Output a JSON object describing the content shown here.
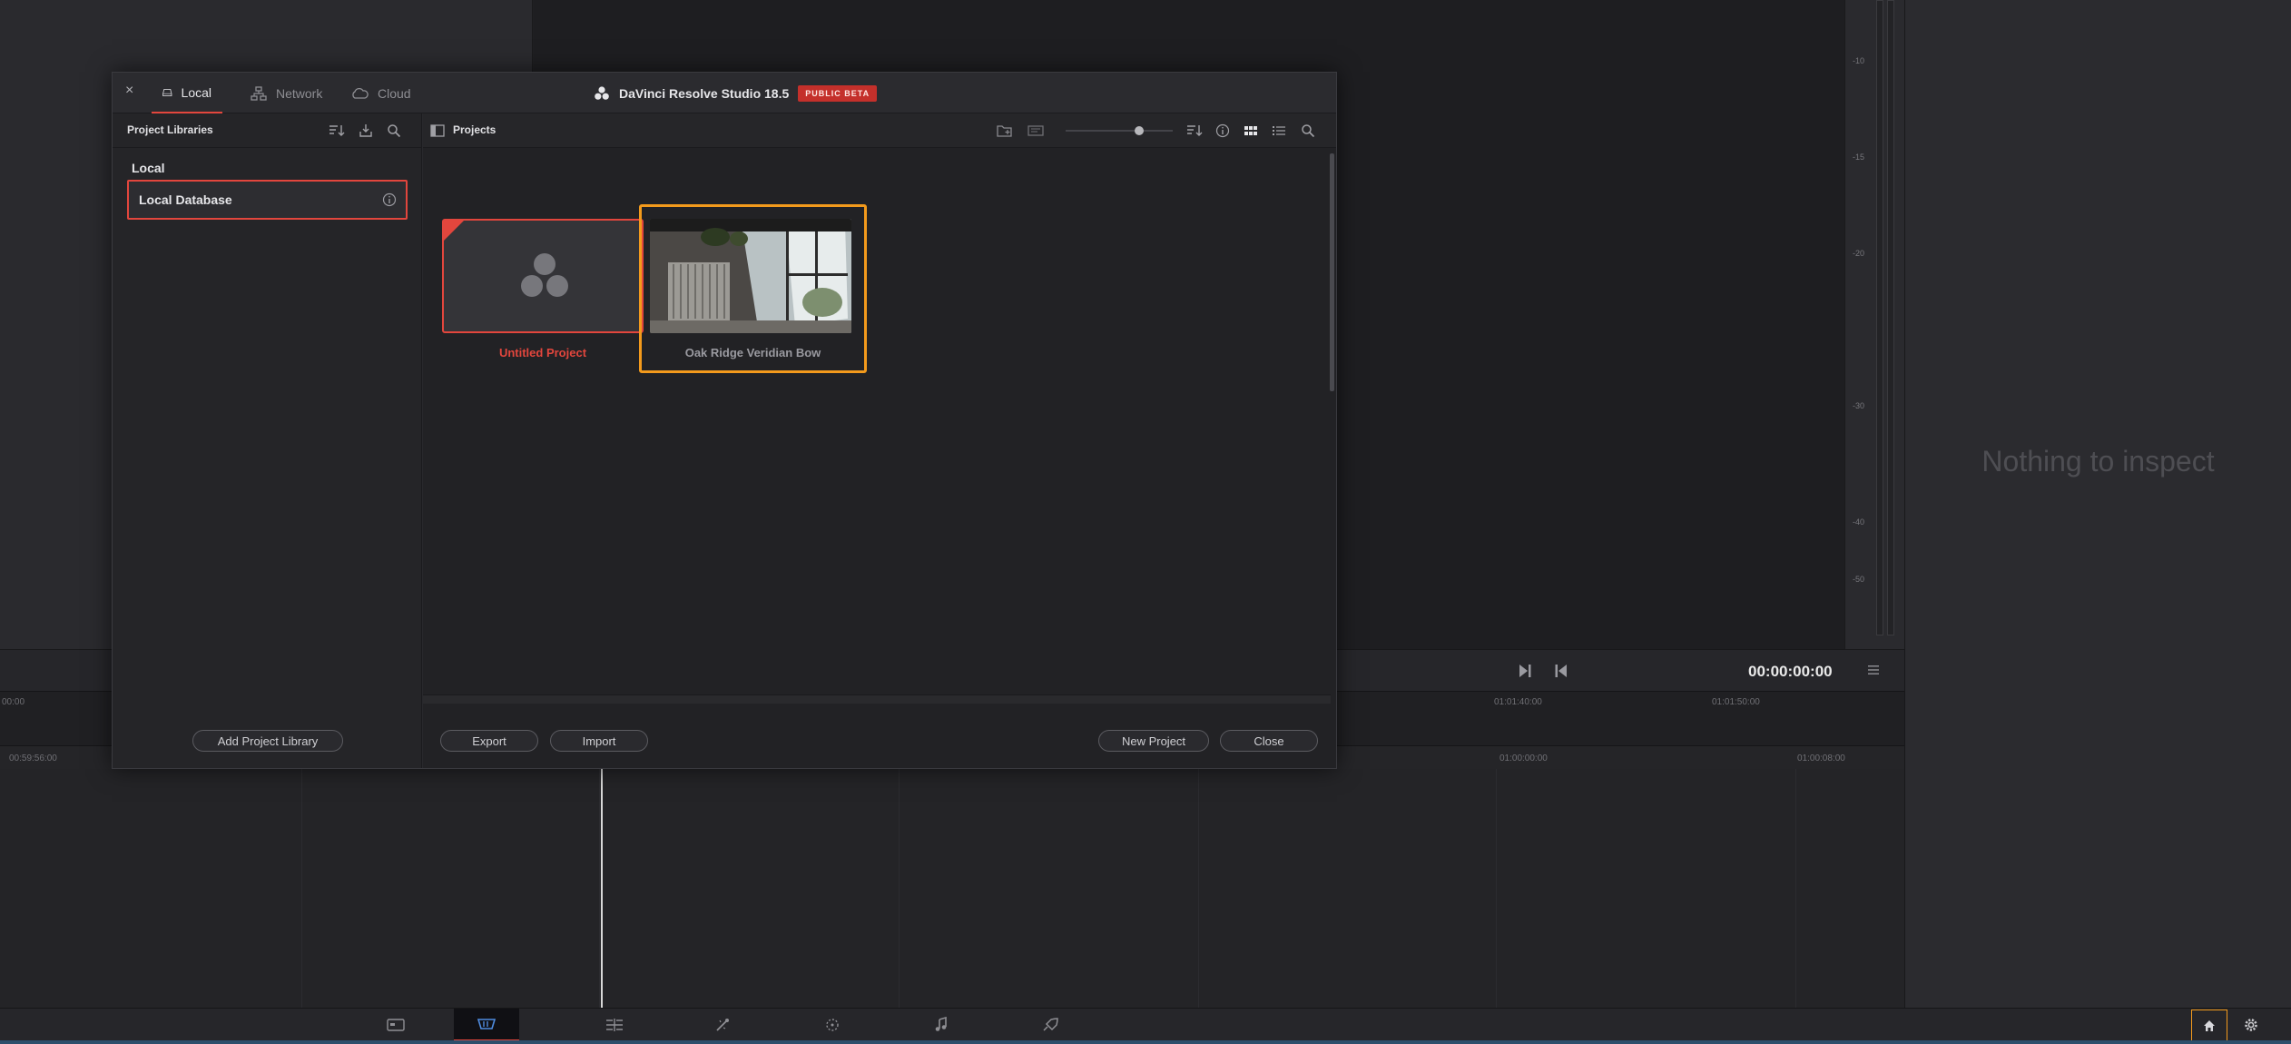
{
  "background": {
    "meter_ticks": [
      "-10",
      "-15",
      "-20",
      "-30",
      "-40",
      "-50"
    ],
    "inspector_empty_text": "Nothing to inspect",
    "timecode": "00:00:00:00",
    "ruler_top": [
      "00:00",
      "01:01:40:00",
      "01:01:50:00"
    ],
    "ruler_bottom": [
      "00:59:56:00",
      "01:00:00:00",
      "01:00:08:00"
    ]
  },
  "page_nav": {
    "items": [
      "media-page-icon",
      "cut-page-icon",
      "edit-page-icon",
      "fusion-page-icon",
      "color-page-icon",
      "fairlight-page-icon",
      "deliver-page-icon"
    ],
    "active": "cut-page-icon"
  },
  "dialog": {
    "close_symbol": "×",
    "tabs": [
      {
        "label": "Local",
        "icon": "drive-icon",
        "active": true
      },
      {
        "label": "Network",
        "icon": "network-icon",
        "active": false
      },
      {
        "label": "Cloud",
        "icon": "cloud-icon",
        "active": false
      }
    ],
    "title": "DaVinci Resolve Studio 18.5",
    "badge": "PUBLIC BETA",
    "left": {
      "header": "Project Libraries",
      "group_label": "Local",
      "database": "Local Database",
      "add_button": "Add Project Library"
    },
    "right": {
      "header": "Projects",
      "projects": [
        {
          "name": "Untitled Project",
          "selected": true
        },
        {
          "name": "Oak Ridge Veridian Bow",
          "selected": false
        }
      ],
      "export_button": "Export",
      "import_button": "Import",
      "new_button": "New Project",
      "close_button": "Close"
    }
  },
  "colors": {
    "accent_red": "#e2463d",
    "highlight_orange": "#f39a1c"
  }
}
